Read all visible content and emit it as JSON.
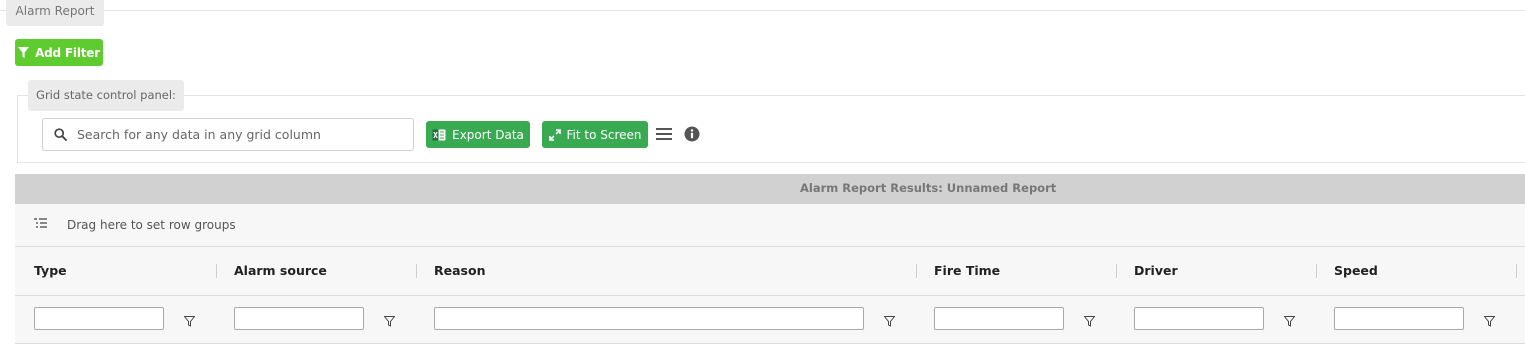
{
  "tab": {
    "label": "Alarm Report"
  },
  "toolbar": {
    "add_filter_label": "Add Filter"
  },
  "grid_panel": {
    "legend": "Grid state control panel:",
    "search_placeholder": "Search for any data in any grid column",
    "export_label": "Export Data",
    "fit_label": "Fit to Screen"
  },
  "results": {
    "title": "Alarm Report Results: Unnamed Report",
    "group_hint": "Drag here to set row groups",
    "columns": [
      {
        "label": "Type"
      },
      {
        "label": "Alarm source"
      },
      {
        "label": "Reason"
      },
      {
        "label": "Fire Time"
      },
      {
        "label": "Driver"
      },
      {
        "label": "Speed"
      }
    ]
  },
  "colors": {
    "add_filter_bg": "#5ecb2f",
    "action_button_bg": "#3aaa52",
    "header_bar_bg": "#d1d1d1"
  }
}
